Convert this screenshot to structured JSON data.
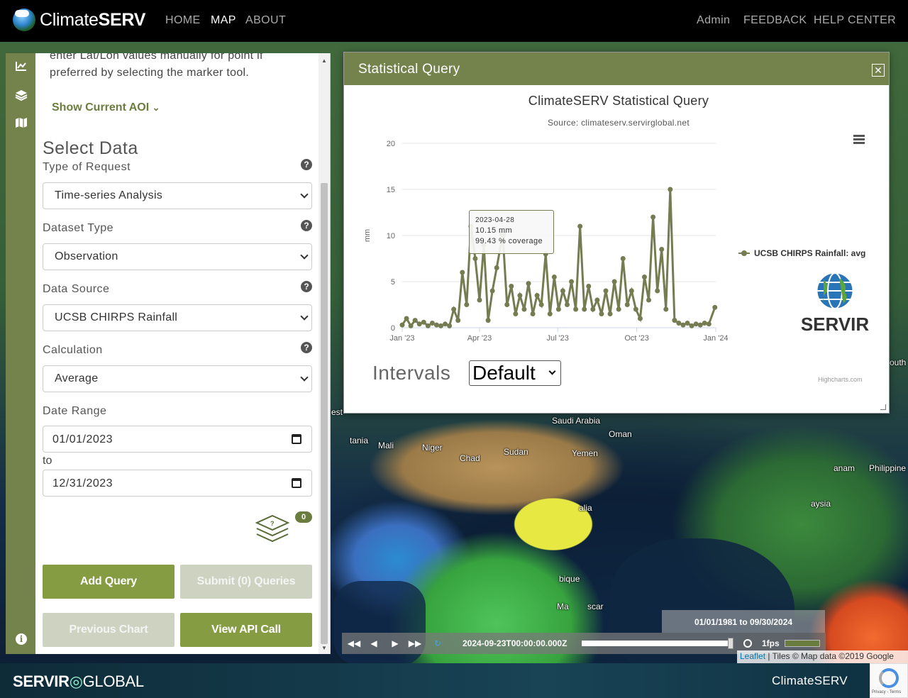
{
  "header": {
    "brand_light": "Climate",
    "brand_bold": "SERV",
    "nav_left": [
      "HOME",
      "MAP",
      "ABOUT"
    ],
    "nav_right": [
      "Admin",
      "FEEDBACK",
      "HELP CENTER"
    ],
    "active": "MAP"
  },
  "map": {
    "labels": [
      "Saudi Arabia",
      "Oman",
      "Mali",
      "Niger",
      "Chad",
      "Sudan",
      "Yemen",
      "alia",
      "bique",
      "Ma",
      "scar",
      "anam",
      "Philippine",
      "aysia",
      "tania",
      "est",
      "outh"
    ]
  },
  "panel": {
    "help_text": "enter Lat/Lon values manually for point if preferred by selecting the marker tool.",
    "aoi_toggle": "Show Current AOI",
    "section_title": "Select Data",
    "request_type_label": "Type of Request",
    "request_type_value": "Time-series Analysis",
    "dataset_type_label": "Dataset Type",
    "dataset_type_value": "Observation",
    "data_source_label": "Data Source",
    "data_source_value": "UCSB CHIRPS Rainfall",
    "calculation_label": "Calculation",
    "calculation_value": "Average",
    "date_range_label": "Date Range",
    "date_from": "01/01/2023",
    "to_label": "to",
    "date_to": "12/31/2023",
    "query_count": "0",
    "add_query": "Add Query",
    "submit_queries": "Submit (0) Queries",
    "previous_chart": "Previous Chart",
    "view_api": "View API Call"
  },
  "modal": {
    "title": "Statistical Query",
    "intervals_label": "Intervals",
    "intervals_value": "Default",
    "credits": "Highcharts.com",
    "servir_logo_text": "SERVIR"
  },
  "chart_data": {
    "type": "line",
    "title": "ClimateSERV Statistical Query",
    "subtitle": "Source: climateserv.servirglobal.net",
    "ylabel": "mm",
    "ylim": [
      0,
      20
    ],
    "yticks": [
      0,
      5,
      10,
      15,
      20
    ],
    "xticks": [
      "Jan '23",
      "Apr '23",
      "Jul '23",
      "Oct '23",
      "Jan '24"
    ],
    "series": [
      {
        "name": "UCSB CHIRPS Rainfall: avg",
        "color": "#757c52",
        "x": [
          "2023-01-01",
          "2023-01-06",
          "2023-01-11",
          "2023-01-16",
          "2023-01-21",
          "2023-01-26",
          "2023-01-31",
          "2023-02-05",
          "2023-02-10",
          "2023-02-15",
          "2023-02-20",
          "2023-02-25",
          "2023-03-02",
          "2023-03-07",
          "2023-03-12",
          "2023-03-17",
          "2023-03-22",
          "2023-03-27",
          "2023-04-01",
          "2023-04-06",
          "2023-04-11",
          "2023-04-16",
          "2023-04-21",
          "2023-04-28",
          "2023-05-03",
          "2023-05-08",
          "2023-05-13",
          "2023-05-18",
          "2023-05-23",
          "2023-05-28",
          "2023-06-02",
          "2023-06-07",
          "2023-06-12",
          "2023-06-17",
          "2023-06-22",
          "2023-06-27",
          "2023-07-02",
          "2023-07-07",
          "2023-07-12",
          "2023-07-17",
          "2023-07-22",
          "2023-07-27",
          "2023-08-01",
          "2023-08-06",
          "2023-08-11",
          "2023-08-16",
          "2023-08-21",
          "2023-08-26",
          "2023-08-31",
          "2023-09-05",
          "2023-09-10",
          "2023-09-15",
          "2023-09-20",
          "2023-09-25",
          "2023-09-30",
          "2023-10-05",
          "2023-10-10",
          "2023-10-15",
          "2023-10-20",
          "2023-10-25",
          "2023-10-30",
          "2023-11-04",
          "2023-11-09",
          "2023-11-14",
          "2023-11-19",
          "2023-11-24",
          "2023-11-29",
          "2023-12-04",
          "2023-12-09",
          "2023-12-14",
          "2023-12-19",
          "2023-12-24",
          "2023-12-31"
        ],
        "y": [
          0.3,
          1.0,
          0.2,
          0.8,
          0.4,
          0.6,
          0.2,
          0.5,
          0.3,
          0.2,
          0.4,
          0.2,
          2.0,
          0.8,
          6.0,
          2.5,
          11.0,
          7.5,
          3.0,
          9.0,
          0.8,
          4.0,
          6.5,
          10.15,
          2.5,
          4.5,
          1.5,
          3.5,
          2.0,
          4.8,
          1.5,
          3.5,
          2.5,
          8.0,
          1.5,
          5.5,
          2.0,
          4.0,
          2.5,
          5.0,
          2.0,
          11.0,
          2.0,
          4.5,
          2.0,
          3.0,
          1.5,
          4.0,
          1.5,
          5.0,
          2.0,
          7.5,
          2.5,
          4.0,
          2.0,
          1.0,
          5.5,
          3.0,
          12.0,
          4.0,
          8.5,
          2.0,
          15.0,
          0.8,
          0.5,
          0.3,
          0.5,
          0.2,
          0.4,
          0.3,
          0.5,
          0.4,
          2.2
        ]
      }
    ],
    "tooltip": {
      "date": "2023-04-28",
      "value": "10.15 mm",
      "coverage": "99.43 % coverage"
    },
    "legend": "right",
    "grid": true
  },
  "timeline": {
    "range": "01/01/1981 to 09/30/2024",
    "current_time": "2024-09-23T00:00:00.000Z",
    "speed": "1fps"
  },
  "attribution": {
    "leaflet": "Leaflet",
    "tiles": "| Tiles © Map data ©2019 Google"
  },
  "footer": {
    "left_bold": "SERVIR",
    "left_light": "GLOBAL",
    "right": "ClimateSERV"
  }
}
